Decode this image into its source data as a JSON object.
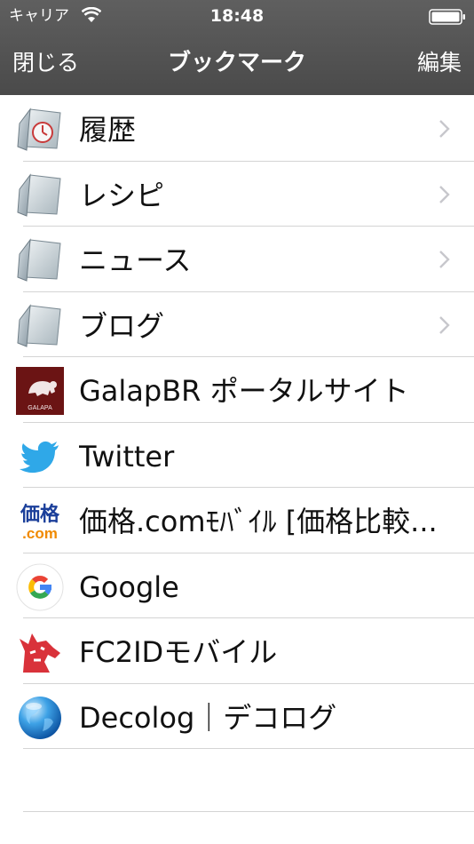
{
  "status": {
    "carrier": "キャリア",
    "time": "18:48"
  },
  "nav": {
    "close_label": "閉じる",
    "title": "ブックマーク",
    "edit_label": "編集"
  },
  "bookmarks": [
    {
      "label": "履歴",
      "icon": "history-folder-icon",
      "chevron": true
    },
    {
      "label": "レシピ",
      "icon": "folder-icon",
      "chevron": true
    },
    {
      "label": "ニュース",
      "icon": "folder-icon",
      "chevron": true
    },
    {
      "label": "ブログ",
      "icon": "folder-icon",
      "chevron": true
    },
    {
      "label": "GalapBR ポータルサイト",
      "icon": "galapa-logo-icon",
      "icon_text": "GALAPA",
      "chevron": false
    },
    {
      "label": "Twitter",
      "icon": "twitter-bird-icon",
      "chevron": false
    },
    {
      "label": "価格.comﾓﾊﾞｲﾙ [価格比較...",
      "icon": "kakaku-logo-icon",
      "icon_text": "価格",
      "icon_text_2": ".com",
      "chevron": false
    },
    {
      "label": "Google",
      "icon": "google-g-icon",
      "chevron": false
    },
    {
      "label": "FC2IDモバイル",
      "icon": "fc2-logo-icon",
      "chevron": false
    },
    {
      "label": "Decolog｜デコログ",
      "icon": "globe-icon",
      "chevron": false
    }
  ],
  "colors": {
    "header": "#555555",
    "separator": "#d4d4d4",
    "text": "#111111",
    "chevron": "#c7c7cc"
  }
}
